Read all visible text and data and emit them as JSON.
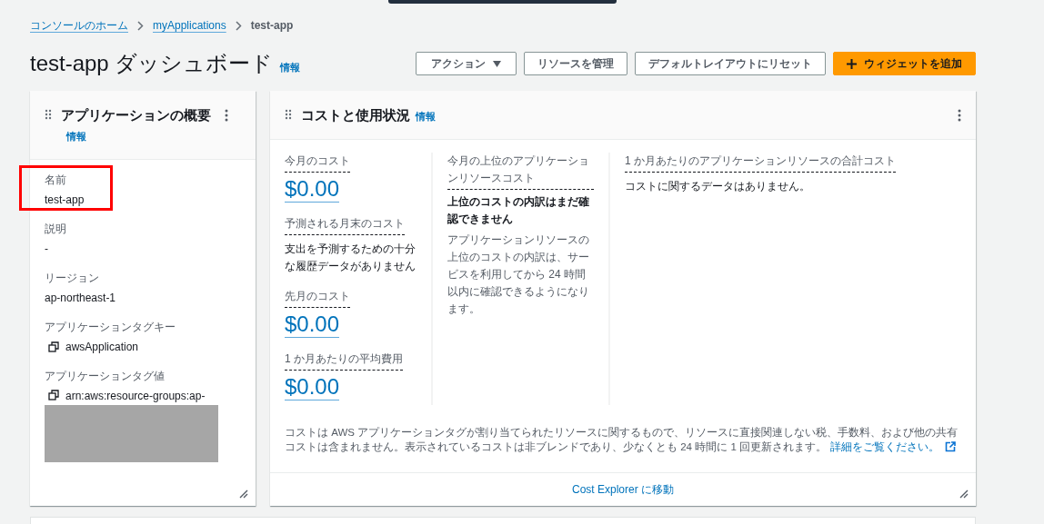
{
  "breadcrumb": [
    {
      "label": "コンソールのホーム",
      "kind": "link"
    },
    {
      "label": "myApplications",
      "kind": "link"
    },
    {
      "label": "test-app",
      "kind": "current"
    }
  ],
  "page": {
    "title": "test-app ダッシュボード",
    "info": "情報"
  },
  "actions": [
    {
      "label": "アクション",
      "kind": "dropdown"
    },
    {
      "label": "リソースを管理",
      "kind": "normal"
    },
    {
      "label": "デフォルトレイアウトにリセット",
      "kind": "normal"
    },
    {
      "label": "ウィジェットを追加",
      "kind": "primary"
    }
  ],
  "overview": {
    "title": "アプリケーションの概要",
    "info": "情報",
    "fields": [
      {
        "label": "名前",
        "value": "test-app",
        "kind": "text",
        "highlighted": true,
        "redacted": false
      },
      {
        "label": "説明",
        "value": "-",
        "kind": "text",
        "highlighted": false,
        "redacted": false
      },
      {
        "label": "リージョン",
        "value": "ap-northeast-1",
        "kind": "text",
        "highlighted": false,
        "redacted": false
      },
      {
        "label": "アプリケーションタグキー",
        "value": "awsApplication",
        "kind": "copy",
        "highlighted": false,
        "redacted": false
      },
      {
        "label": "アプリケーションタグ値",
        "value": "arn:aws:resource-groups:ap-",
        "kind": "copy",
        "highlighted": false,
        "redacted": true
      }
    ]
  },
  "cost": {
    "title": "コストと使用状況",
    "info": "情報",
    "columns": [
      [
        {
          "label": "今月のコスト",
          "value": "$0.00",
          "kind": "amount"
        },
        {
          "label": "予測される月末のコスト",
          "value": "支出を予測するための十分な履歴データがありません",
          "kind": "note"
        },
        {
          "label": "先月のコスト",
          "value": "$0.00",
          "kind": "amount"
        },
        {
          "label": "1 か月あたりの平均費用",
          "value": "$0.00",
          "kind": "amount"
        }
      ],
      [
        {
          "label": "今月の上位のアプリケーションリソースコスト",
          "heading": "上位のコストの内訳はまだ確認できません",
          "value": "アプリケーションリソースの上位のコストの内訳は、サービスを利用してから 24 時間以内に確認できるようになります。",
          "kind": "message"
        }
      ],
      [
        {
          "label": "1 か月あたりのアプリケーションリソースの合計コスト",
          "value": "コストに関するデータはありません。",
          "kind": "note"
        }
      ]
    ],
    "footnote": "コストは AWS アプリケーションタグが割り当てられたリソースに関するもので、リソースに直接関連しない税、手数料、および他の共有コストは含まれません。表示されているコストは非ブレンドであり、少なくとも 24 時間に 1 回更新されます。",
    "footnote_link": "詳細をご覧ください。",
    "footer_link": "Cost Explorer に移動"
  }
}
